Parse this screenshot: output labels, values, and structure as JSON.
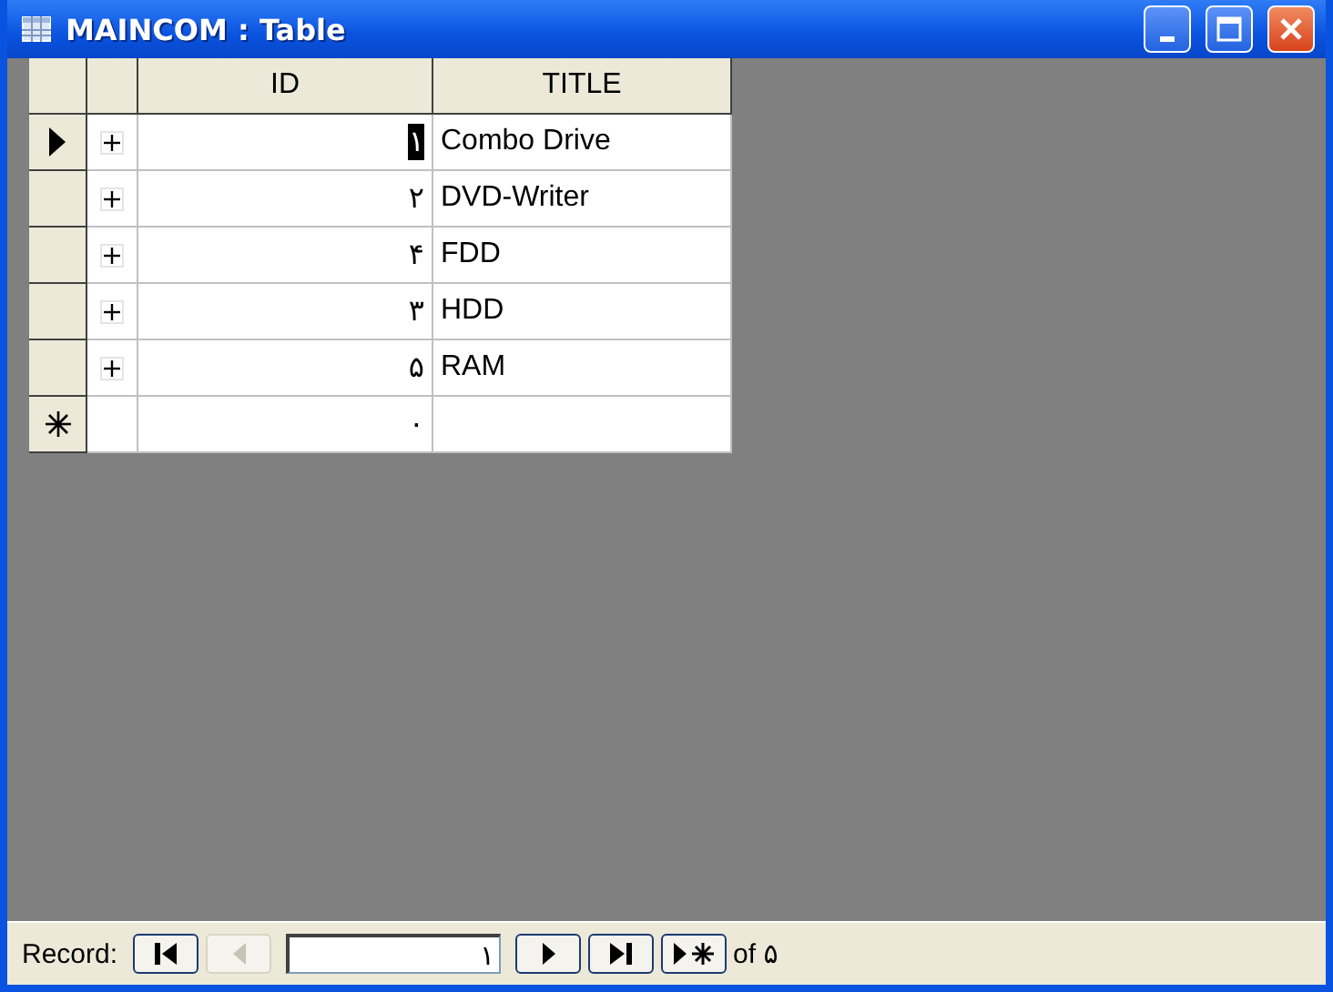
{
  "window": {
    "title": "MAINCOM : Table"
  },
  "table": {
    "columns": [
      "ID",
      "TITLE"
    ],
    "rows": [
      {
        "kind": "record",
        "selected": true,
        "expanded": false,
        "id": "۱",
        "title": "Combo Drive"
      },
      {
        "kind": "record",
        "selected": false,
        "expanded": false,
        "id": "۲",
        "title": "DVD-Writer"
      },
      {
        "kind": "record",
        "selected": false,
        "expanded": false,
        "id": "۴",
        "title": "FDD"
      },
      {
        "kind": "record",
        "selected": false,
        "expanded": false,
        "id": "۳",
        "title": "HDD"
      },
      {
        "kind": "record",
        "selected": false,
        "expanded": false,
        "id": "۵",
        "title": "RAM"
      },
      {
        "kind": "new",
        "selected": false,
        "id": "۰",
        "title": ""
      }
    ]
  },
  "navigation": {
    "label": "Record:",
    "current": "۱",
    "of_label": "of",
    "total": "۵",
    "buttons": [
      {
        "kind": "first",
        "disabled": false
      },
      {
        "kind": "prev",
        "disabled": true
      },
      {
        "kind": "next",
        "disabled": false
      },
      {
        "kind": "last",
        "disabled": false
      },
      {
        "kind": "new",
        "disabled": false
      }
    ]
  }
}
